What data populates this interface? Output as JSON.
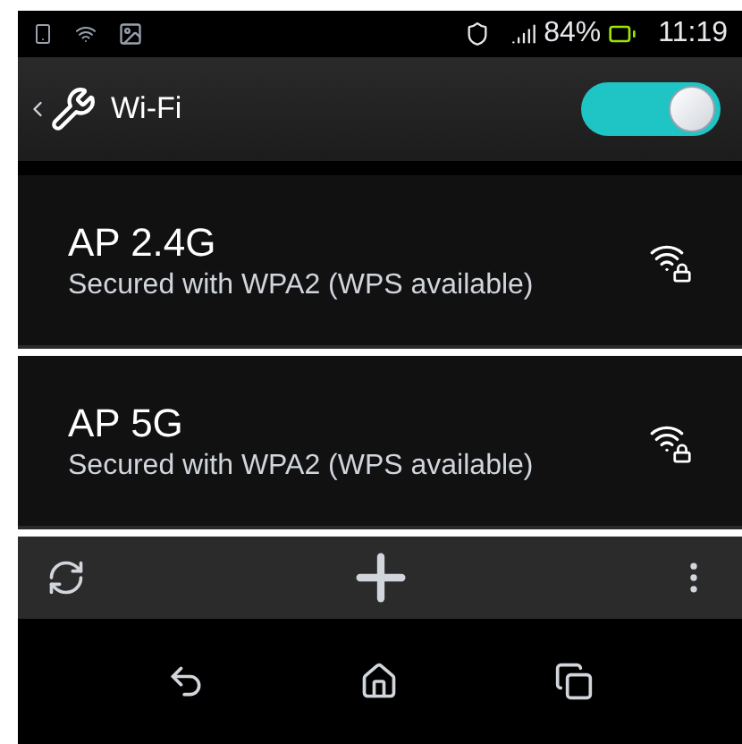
{
  "status_bar": {
    "battery": "84%",
    "time": "11:19"
  },
  "action_bar": {
    "title": "Wi-Fi",
    "wifi_switch": {
      "on": true
    }
  },
  "networks": [
    {
      "name": "AP 2.4G",
      "security": "Secured with WPA2 (WPS available)"
    },
    {
      "name": "AP 5G",
      "security": "Secured with WPA2 (WPS available)"
    }
  ]
}
